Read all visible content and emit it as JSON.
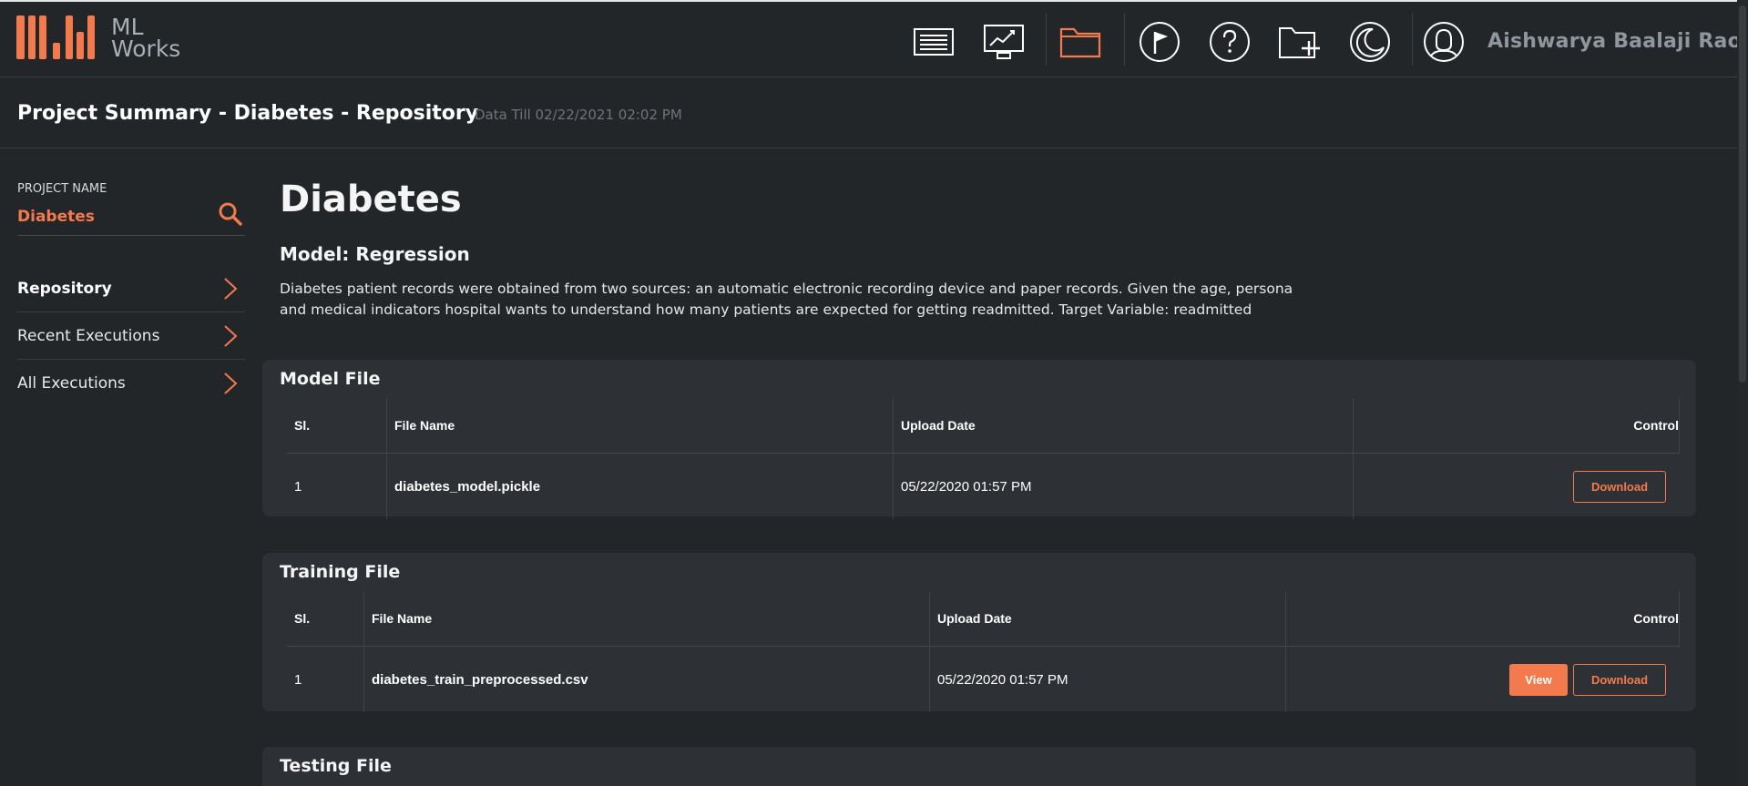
{
  "header": {
    "logo_text_line1": "ML",
    "logo_text_line2": "Works",
    "brand_color": "#f37a4d",
    "nav_icons": [
      "document-list-icon",
      "monitor-chart-icon",
      "folder-icon",
      "flag-icon",
      "help-icon",
      "add-folder-icon",
      "moon-icon",
      "user-icon"
    ],
    "active_icon": "folder-icon",
    "user_name": "Aishwarya Baalaji Rao"
  },
  "subheader": {
    "title": "Project Summary - Diabetes - Repository",
    "data_till": "Data Till 02/22/2021 02:02 PM"
  },
  "sidebar": {
    "project_label": "PROJECT NAME",
    "project_name": "Diabetes",
    "items": [
      {
        "label": "Repository",
        "active": true
      },
      {
        "label": "Recent Executions",
        "active": false
      },
      {
        "label": "All Executions",
        "active": false
      }
    ]
  },
  "main": {
    "project_title": "Diabetes",
    "model_type": "Model: Regression",
    "description_line1": "Diabetes patient records were obtained from two sources: an automatic electronic recording device and paper records. Given the age, persona",
    "description_line2": "and medical indicators hospital wants to understand how many patients are expected for getting readmitted. Target Variable: readmitted"
  },
  "model_file": {
    "title": "Model File",
    "columns": [
      "Sl.",
      "File Name",
      "Upload Date",
      "Control"
    ],
    "rows": [
      {
        "sl": "1",
        "file_name": "diabetes_model.pickle",
        "upload_date": "05/22/2020 01:57 PM",
        "download_label": "Download"
      }
    ]
  },
  "training_file": {
    "title": "Training File",
    "columns": [
      "Sl.",
      "File Name",
      "Upload Date",
      "Control"
    ],
    "rows": [
      {
        "sl": "1",
        "file_name": "diabetes_train_preprocessed.csv",
        "upload_date": "05/22/2020 01:57 PM",
        "view_label": "View",
        "download_label": "Download"
      }
    ]
  },
  "testing_file": {
    "title": "Testing File"
  }
}
